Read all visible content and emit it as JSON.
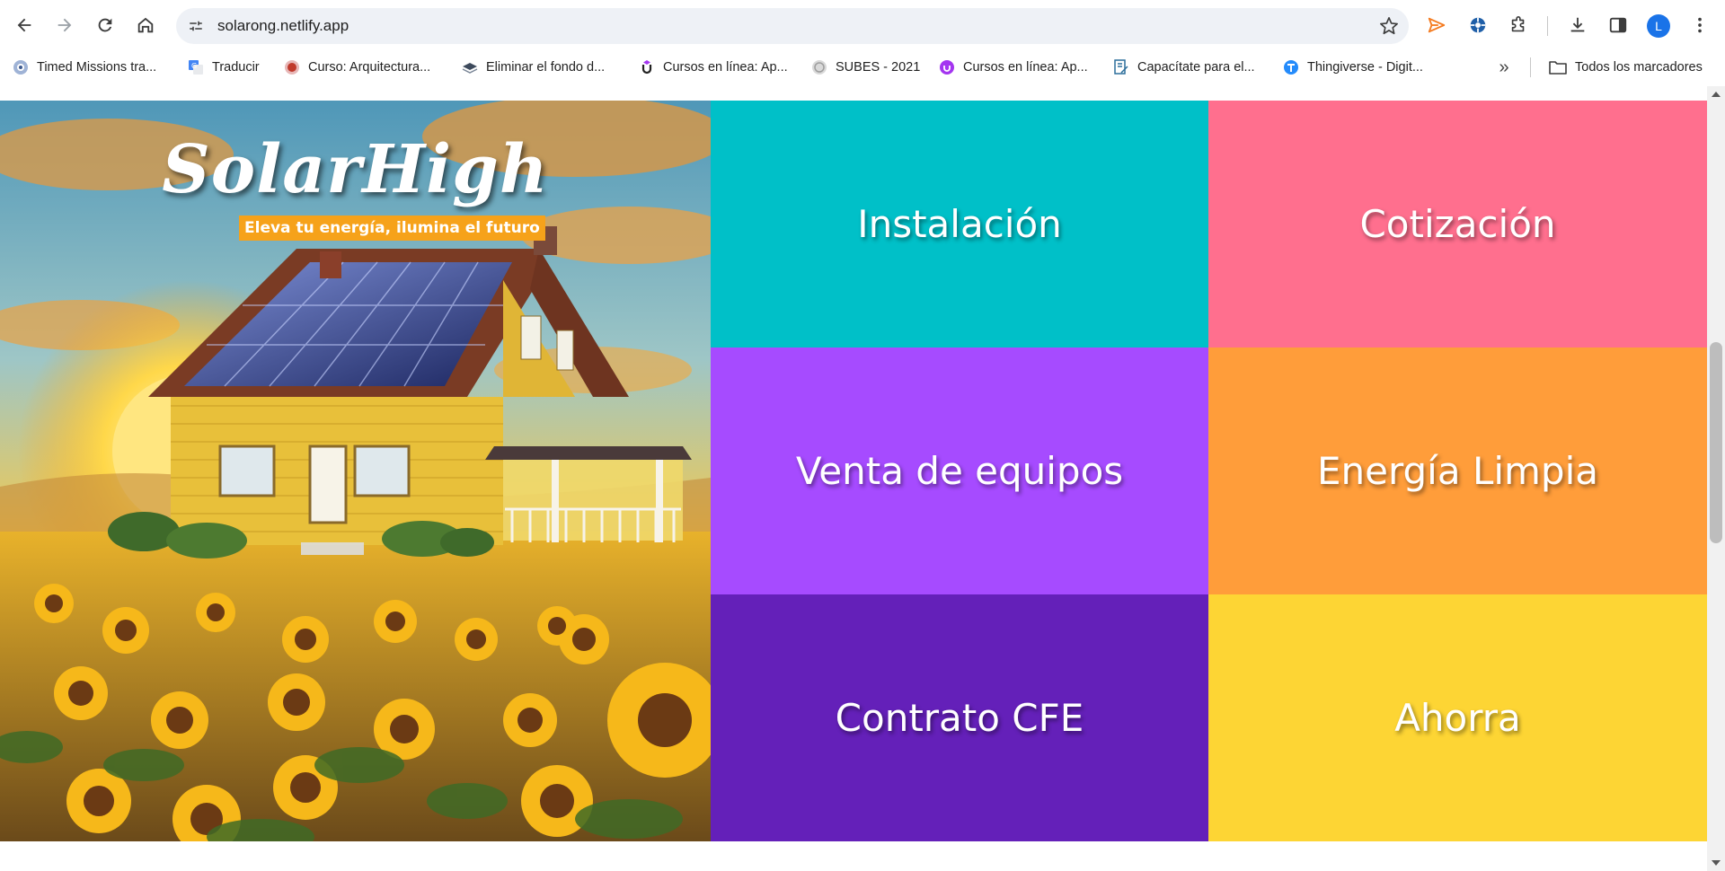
{
  "browser": {
    "url": "solarong.netlify.app",
    "profile_initial": "L",
    "bookmarks": [
      {
        "label": "Timed Missions tra...",
        "icon": "timed-missions-favicon",
        "color": "#7a8fb5"
      },
      {
        "label": "Traducir",
        "icon": "translate-favicon",
        "color": "#4285f4"
      },
      {
        "label": "Curso: Arquitectura...",
        "icon": "curso-favicon",
        "color": "#c0392b"
      },
      {
        "label": "Eliminar el fondo d...",
        "icon": "remove-bg-favicon",
        "color": "#3d4a5c"
      },
      {
        "label": "Cursos en línea: Ap...",
        "icon": "udemy-favicon",
        "color": "#222222"
      },
      {
        "label": "SUBES - 2021",
        "icon": "subes-favicon",
        "color": "#9e9e9e"
      },
      {
        "label": "Cursos en línea: Ap...",
        "icon": "udemy-purple-favicon",
        "color": "#a435f0"
      },
      {
        "label": "Capacítate para el...",
        "icon": "capacitate-favicon",
        "color": "#2c6e9b"
      },
      {
        "label": "Thingiverse - Digit...",
        "icon": "thingiverse-favicon",
        "color": "#248bfb"
      }
    ],
    "all_bookmarks_label": "Todos los marcadores"
  },
  "hero": {
    "brand": "SolarHigh",
    "tagline": "Eleva tu energía, ilumina el futuro"
  },
  "tiles": [
    {
      "label": "Instalación",
      "color": "#00c0c8"
    },
    {
      "label": "Cotización",
      "color": "#ff6f8e"
    },
    {
      "label": "Venta de equipos",
      "color": "#a64bff"
    },
    {
      "label": "Energía Limpia",
      "color": "#ff9d3a"
    },
    {
      "label": "Contrato CFE",
      "color": "#6420b9"
    },
    {
      "label": "Ahorra",
      "color": "#fdd534"
    }
  ]
}
